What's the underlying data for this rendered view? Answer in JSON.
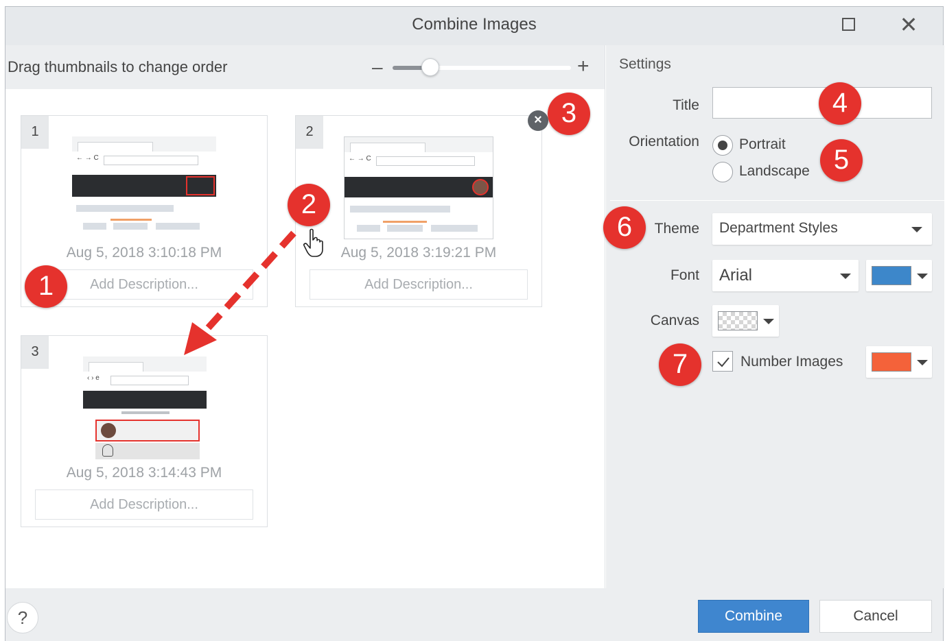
{
  "window": {
    "title": "Combine Images",
    "maximize_icon": "maximize-icon",
    "close_icon": "close-icon",
    "close_glyph": "✕"
  },
  "toolbar": {
    "hint": "Drag thumbnails to change order",
    "zoom_minus": "–",
    "zoom_plus": "+",
    "zoom_level": 0.18
  },
  "images": [
    {
      "number": "1",
      "date": "Aug 5, 2018 3:10:18 PM",
      "description_placeholder": "Add Description..."
    },
    {
      "number": "2",
      "date": "Aug 5, 2018 3:19:21 PM",
      "description_placeholder": "Add Description..."
    },
    {
      "number": "3",
      "date": "Aug 5, 2018 3:14:43 PM",
      "description_placeholder": "Add Description..."
    }
  ],
  "remove_glyph": "×",
  "settings": {
    "heading": "Settings",
    "title_label": "Title",
    "title_value": "",
    "orientation_label": "Orientation",
    "orientation_options": [
      "Portrait",
      "Landscape"
    ],
    "orientation_selected": "Portrait",
    "theme_label": "Theme",
    "theme_value": "Department Styles",
    "font_label": "Font",
    "font_value": "Arial",
    "font_color": "#3d87ca",
    "canvas_label": "Canvas",
    "canvas_value": "transparent",
    "number_images_label": "Number Images",
    "number_images_checked": true,
    "number_color": "#f4623a"
  },
  "footer": {
    "help": "?",
    "combine": "Combine",
    "cancel": "Cancel"
  },
  "callouts": [
    "1",
    "2",
    "3",
    "4",
    "5",
    "6",
    "7"
  ],
  "colors": {
    "callout": "#e5322d",
    "arrow": "#e5322d",
    "primary_button": "#3f86cf"
  }
}
